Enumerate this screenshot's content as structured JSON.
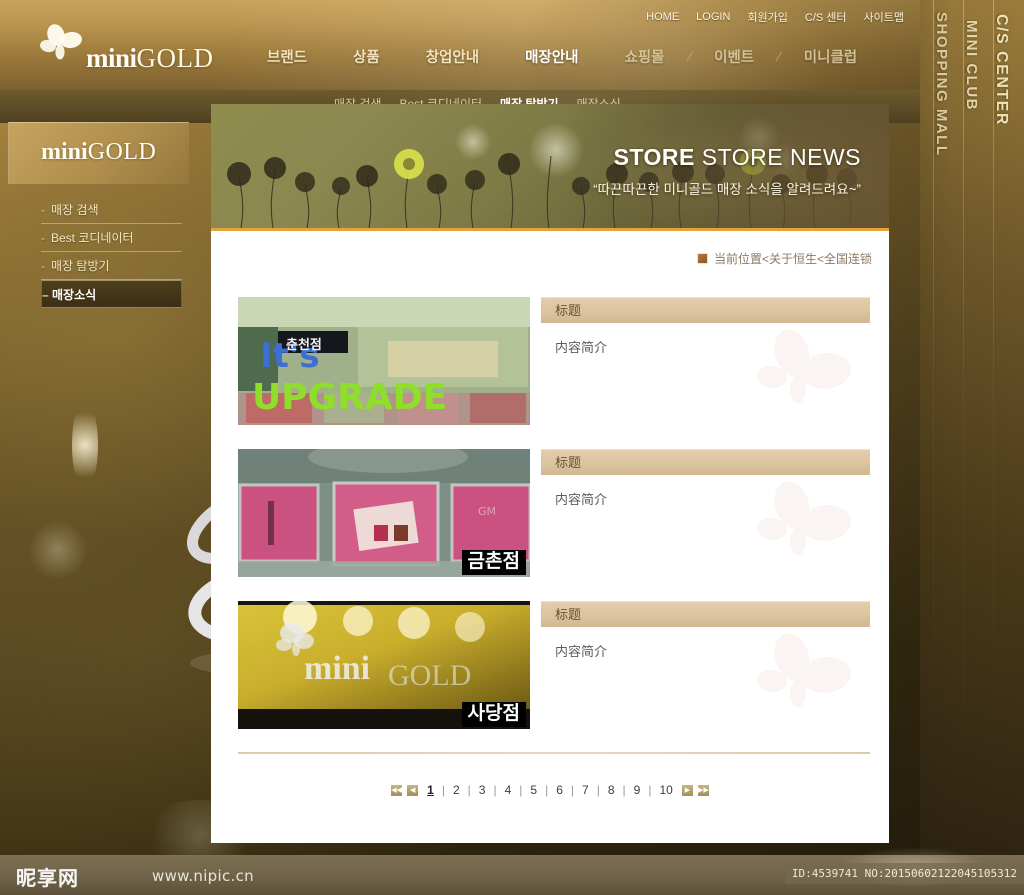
{
  "brand": {
    "logo_mini": "mini",
    "logo_gold": "GOLD",
    "butterfly_icon": "butterfly-icon"
  },
  "utility_nav": [
    {
      "label": "HOME"
    },
    {
      "label": "LOGIN"
    },
    {
      "label": "회원가입"
    },
    {
      "label": "C/S 센터"
    },
    {
      "label": "사이트맵"
    }
  ],
  "main_nav": [
    {
      "label": "브랜드",
      "active": false
    },
    {
      "label": "상품",
      "active": false
    },
    {
      "label": "창업안내",
      "active": false
    },
    {
      "label": "매장안내",
      "active": true
    },
    {
      "label": "쇼핑몰",
      "active": false
    },
    {
      "label": "이벤트",
      "active": false
    },
    {
      "label": "미니클럽",
      "active": false
    }
  ],
  "nav_separator": "/",
  "sub_nav": [
    {
      "label": "매장 검색",
      "active": false
    },
    {
      "label": "Best 코디네이터",
      "active": false
    },
    {
      "label": "매장 탐방기",
      "active": true
    },
    {
      "label": "매장소식",
      "active": false
    }
  ],
  "right_rail": [
    {
      "label": "C/S CENTER"
    },
    {
      "label": "MINI CLUB"
    },
    {
      "label": "SHOPPING MALL"
    }
  ],
  "hero": {
    "title_bold": "STORE",
    "title_light": " STORE NEWS",
    "subtitle": "“따끈따끈한 미니골드 매장 소식을 알려드려요~”"
  },
  "sidebar": {
    "logo_mini": "mini",
    "logo_gold": "GOLD",
    "items": [
      {
        "label": "매장 검색",
        "marker": "-",
        "active": false
      },
      {
        "label": "Best 코디네이터",
        "marker": "-",
        "active": false
      },
      {
        "label": "매장 탐방기",
        "marker": "-",
        "active": false
      },
      {
        "label": "매장소식",
        "marker": "–",
        "active": true
      }
    ]
  },
  "breadcrumb": {
    "icon": "location-icon",
    "text": "当前位置<关于恒生<全国连锁"
  },
  "news_items": [
    {
      "title": "标题",
      "summary": "内容简介",
      "thumb_badge": "",
      "thumb_alt": "store-photo-upgrade",
      "thumb_overlay_top": "It's",
      "thumb_overlay_bottom": "UPGRADE"
    },
    {
      "title": "标题",
      "summary": "内容简介",
      "thumb_badge": "금촌점",
      "thumb_alt": "store-photo-display-cases"
    },
    {
      "title": "标题",
      "summary": "内容简介",
      "thumb_badge": "사당점",
      "thumb_alt": "store-photo-signage",
      "thumb_sign_mini": "mini",
      "thumb_sign_gold": "GOLD"
    }
  ],
  "pagination": {
    "first_label": "◀◀",
    "prev_label": "◀",
    "next_label": "▶",
    "last_label": "▶▶",
    "pages": [
      "1",
      "2",
      "3",
      "4",
      "5",
      "6",
      "7",
      "8",
      "9",
      "10"
    ],
    "current": "1",
    "separator": "|"
  },
  "footer": {
    "watermark_logo": "昵享网",
    "watermark_url": "www.nipic.cn",
    "id_text": "ID:4539741 NO:20150602122045105312"
  },
  "colors": {
    "accent_gold": "#e2a33f",
    "header_gold": "#bb9550",
    "panel_bg": "#ffffff",
    "title_bar": "#dcc49f",
    "hero_olive": "#7d7a45"
  }
}
